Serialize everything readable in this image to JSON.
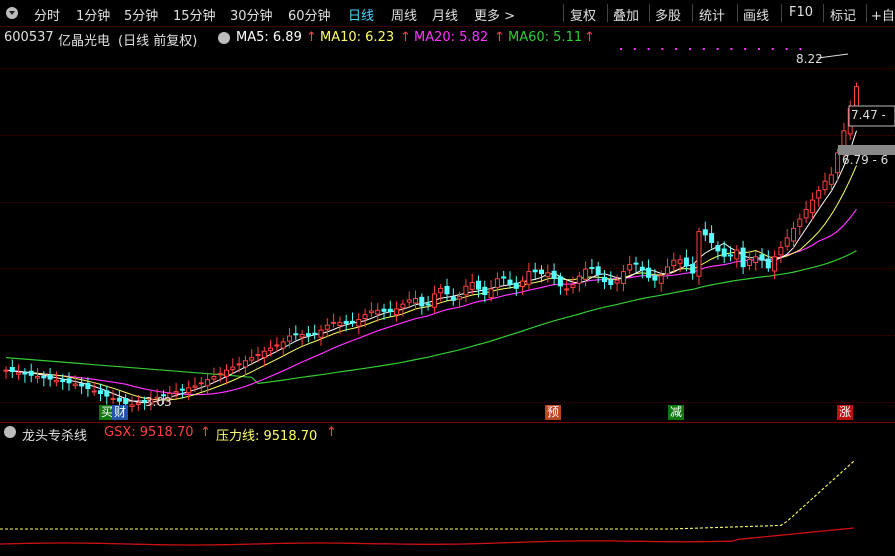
{
  "toolbar": {
    "periods": [
      "分时",
      "1分钟",
      "5分钟",
      "15分钟",
      "30分钟",
      "60分钟",
      "日线",
      "周线",
      "月线",
      "更多 >"
    ],
    "active": "日线",
    "buttons": [
      "复权",
      "叠加",
      "多股",
      "统计",
      "画线",
      "F10",
      "标记",
      "+自"
    ]
  },
  "header": {
    "code": "600537",
    "name": "亿晶光电",
    "mode": "(日线 前复权)",
    "ma5": "MA5: 6.89",
    "ma10": "MA10: 6.23",
    "ma20": "MA20: 5.82",
    "ma60": "MA60: 5.11",
    "arrow": "↑"
  },
  "colors": {
    "up": "#ff4040",
    "down": "#54ffff",
    "ma5": "#ffffff",
    "ma10": "#ffff66",
    "ma20": "#ff33ff",
    "ma60": "#33cc33",
    "label_green": "#33cc33",
    "pressure": "#ffff66"
  },
  "chart_data": [
    {
      "type": "candlestick",
      "title": "600537 亿晶光电(日线 前复权)",
      "series": [
        {
          "name": "MA5",
          "last": 6.89
        },
        {
          "name": "MA10",
          "last": 6.23
        },
        {
          "name": "MA20",
          "last": 5.82
        },
        {
          "name": "MA60",
          "last": 5.11
        }
      ],
      "ylim": [
        2.9,
        8.4
      ],
      "grid": true,
      "annotations": {
        "low": "3.03",
        "high": "8.22",
        "price_labels": [
          "7.47 -",
          "6.79 - 6"
        ],
        "signals": [
          {
            "text": "买",
            "color": "green"
          },
          {
            "text": "财",
            "color": "blue"
          },
          {
            "text": "预",
            "color": "orange"
          },
          {
            "text": "减",
            "color": "green"
          },
          {
            "text": "涨",
            "color": "red"
          }
        ]
      }
    },
    {
      "type": "line",
      "title": "龙头专杀线",
      "series": [
        {
          "name": "GSX",
          "value": "9518.70",
          "color": "red"
        },
        {
          "name": "压力线",
          "value": "9518.70",
          "color": "yellow"
        }
      ]
    }
  ],
  "indicator": {
    "name": "龙头专杀线",
    "gsx": "GSX: 9518.70",
    "pressure": "压力线: 9518.70",
    "arrow": "↑"
  }
}
